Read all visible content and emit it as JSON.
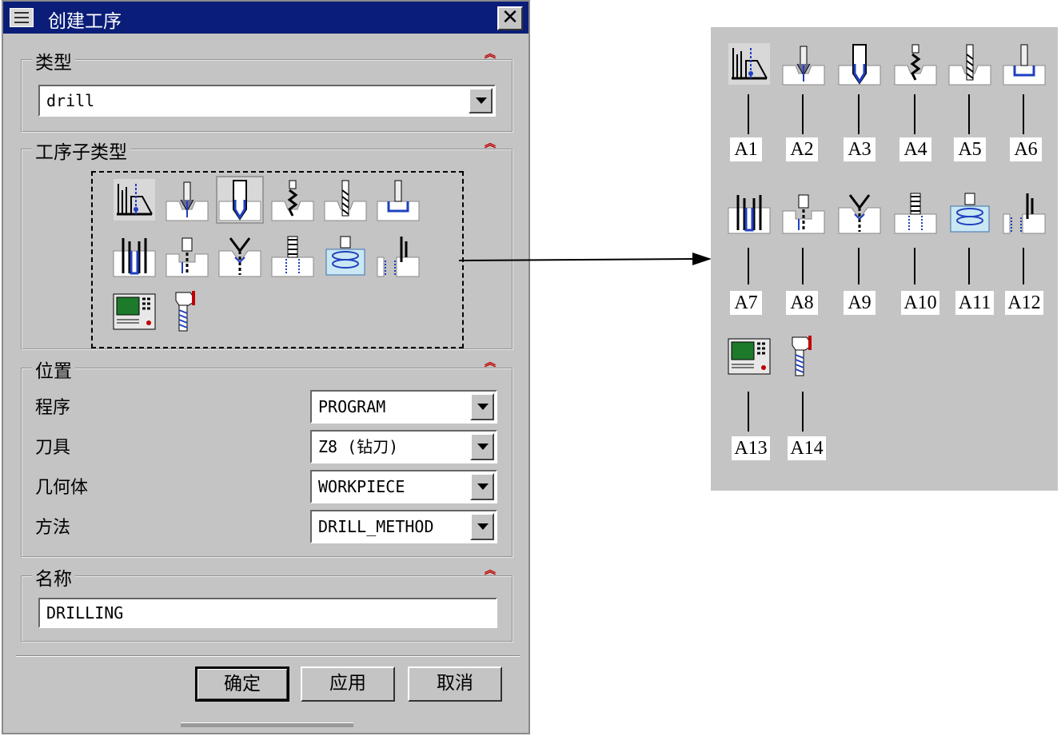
{
  "dialog": {
    "title": "创建工序",
    "type_group": {
      "title": "类型",
      "value": "drill"
    },
    "subtype_group": {
      "title": "工序子类型"
    },
    "location_group": {
      "title": "位置",
      "rows": [
        {
          "label": "程序",
          "value": "PROGRAM"
        },
        {
          "label": "刀具",
          "value": "Z8 (钻刀)"
        },
        {
          "label": "几何体",
          "value": "WORKPIECE"
        },
        {
          "label": "方法",
          "value": "DRILL_METHOD"
        }
      ]
    },
    "name_group": {
      "title": "名称",
      "value": "DRILLING"
    },
    "buttons": {
      "ok": "确定",
      "apply": "应用",
      "cancel": "取消"
    }
  },
  "legend": {
    "labels": [
      "A1",
      "A2",
      "A3",
      "A4",
      "A5",
      "A6",
      "A7",
      "A8",
      "A9",
      "A10",
      "A11",
      "A12",
      "A13",
      "A14"
    ]
  },
  "colors": {
    "titlebar": "#0a1d78",
    "panel": "#c4c4c4",
    "accent_red": "#c00000",
    "icon_blue": "#1f3fbf"
  }
}
